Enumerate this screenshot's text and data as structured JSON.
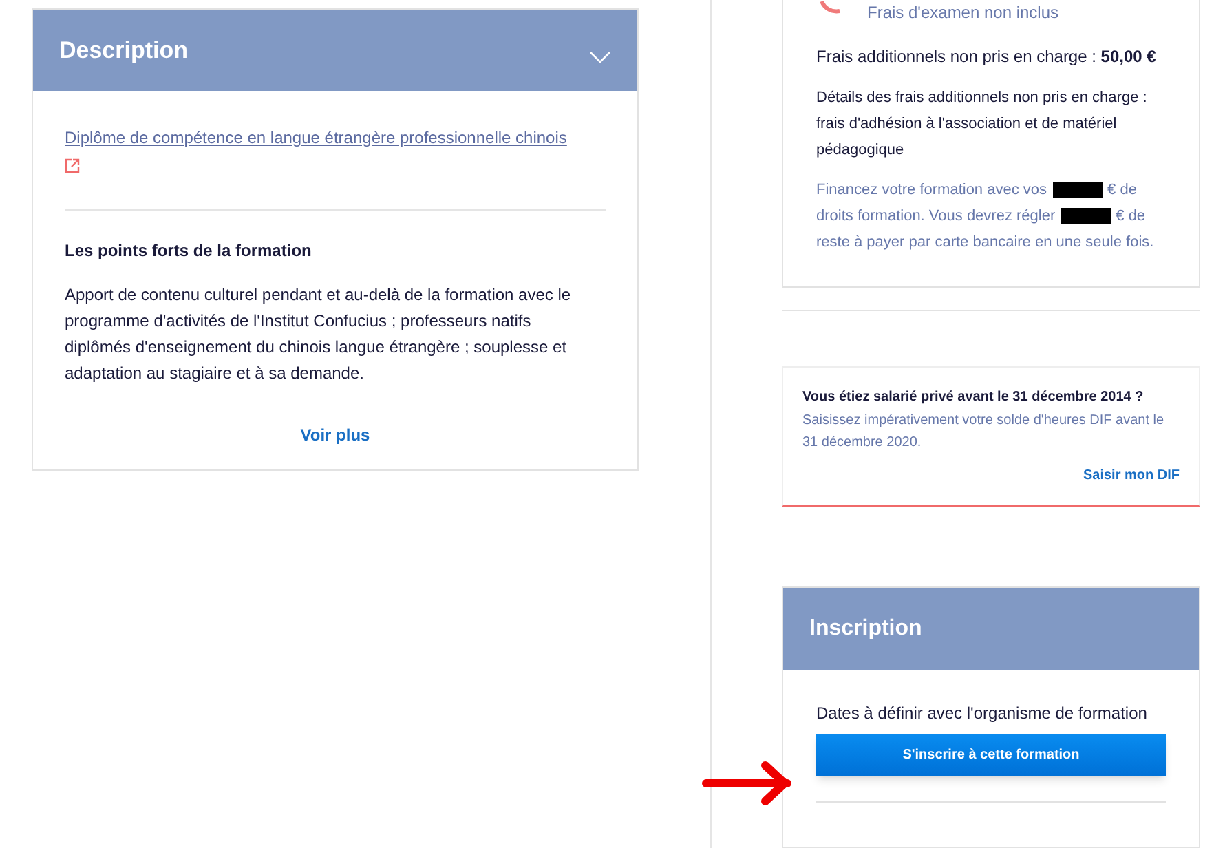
{
  "description": {
    "title": "Description",
    "expanded": true,
    "link": "Diplôme de compétence en langue étrangère professionnelle chinois",
    "highlights_title": "Les points forts de la formation",
    "highlights_text": "Apport de contenu culturel pendant et au-delà de la formation avec le programme d'activités de l'Institut Confucius ; professeurs natifs diplômés d'enseignement du chinois langue étrangère ; souplesse et adaptation au stagiaire et à sa demande.",
    "more": "Voir plus"
  },
  "price": {
    "exam_note": "Frais d'examen non inclus",
    "additional": "Frais additionnels non pris en charge : **50,00 €**",
    "details": "Détails des frais additionnels non pris en charge : frais d'adhésion à l'association et de matériel pédagogique",
    "financing_parts": [
      "Financez votre formation avec vos",
      "€ de droits formation. Vous devrez régler",
      "€ de reste à payer par carte bancaire en une seule fois."
    ]
  },
  "dif": {
    "title": "Vous étiez salarié privé avant le 31 décembre 2014 ?",
    "text": "Saisissez impérativement votre solde d'heures DIF avant le 31 décembre 2020.",
    "link": "Saisir mon DIF"
  },
  "inscription": {
    "title": "Inscription",
    "dates": "Dates à définir avec l'organisme de formation",
    "button": "S'inscrire à cette formation"
  }
}
